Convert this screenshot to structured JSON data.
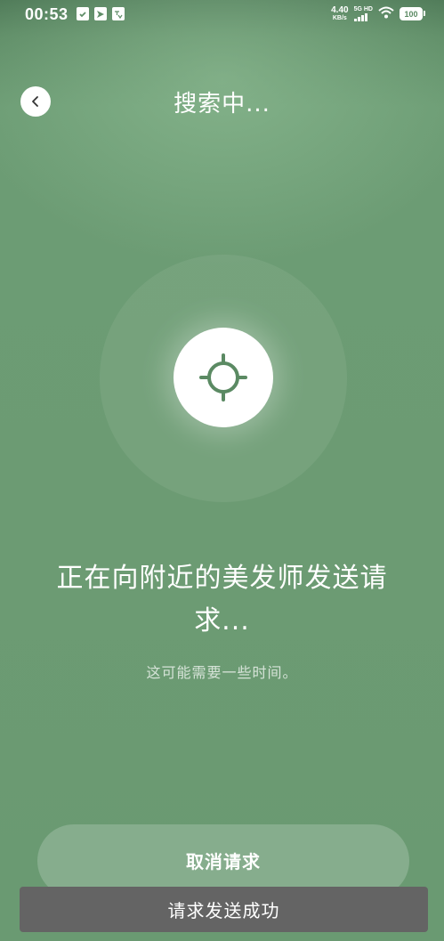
{
  "status_bar": {
    "time": "00:53",
    "net_speed_value": "4.40",
    "net_speed_unit": "KB/s",
    "signal_label": "5G HD",
    "battery": "100",
    "left_icons": [
      "shield-check-icon",
      "arrow-app-icon",
      "translate-app-icon"
    ]
  },
  "header": {
    "title": "搜索中..."
  },
  "search": {
    "message": "正在向附近的美发师发送请求...",
    "submessage": "这可能需要一些时间。"
  },
  "actions": {
    "cancel_label": "取消请求"
  },
  "toast": {
    "text": "请求发送成功"
  },
  "colors": {
    "background": "#6a9a72",
    "accent": "#5b8a63",
    "button": "#86ad8d",
    "toast": "#646464"
  }
}
